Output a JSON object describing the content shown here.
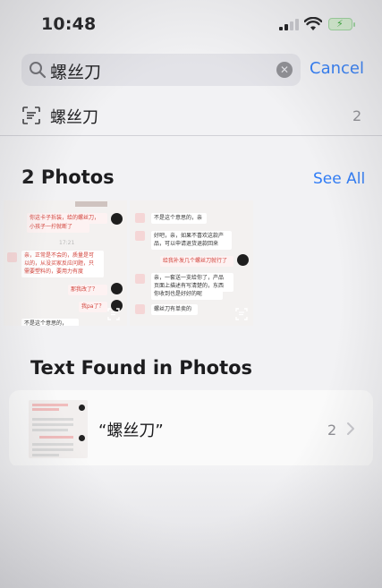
{
  "status_bar": {
    "time": "10:48"
  },
  "search": {
    "query": "螺丝刀",
    "cancel_label": "Cancel"
  },
  "suggestion": {
    "text": "螺丝刀",
    "count": "2"
  },
  "photos": {
    "title": "2 Photos",
    "see_all_label": "See All",
    "thumb1": {
      "lines": [
        "你这卡子拆装，给的螺丝刀，",
        "小孩子一拧就断了",
        "17:21",
        "亲，正常是不会的，质量是可",
        "以的，从没买家反应问题，只",
        "需要塑料的，要用力有度",
        "那我改了？",
        "我pa了？",
        "不是这个意思的，"
      ]
    },
    "thumb2": {
      "lines": [
        "不是这个意思的，亲",
        "好吧，亲，如果不喜欢这款产",
        "品，可以申请退货退款回来",
        "给我补发几个螺丝刀就行了",
        "亲，一套送一支给你了，产品",
        "页面上描述有写清楚的，东西",
        "你收到也是好好的呢",
        "螺丝刀有单卖的"
      ]
    }
  },
  "text_found": {
    "title": "Text Found in Photos",
    "result_text": "“螺丝刀”",
    "result_count": "2"
  },
  "colors": {
    "accent": "#2f7cf6",
    "secondary_text": "#8e8e93",
    "background": "#f2f2f4"
  }
}
